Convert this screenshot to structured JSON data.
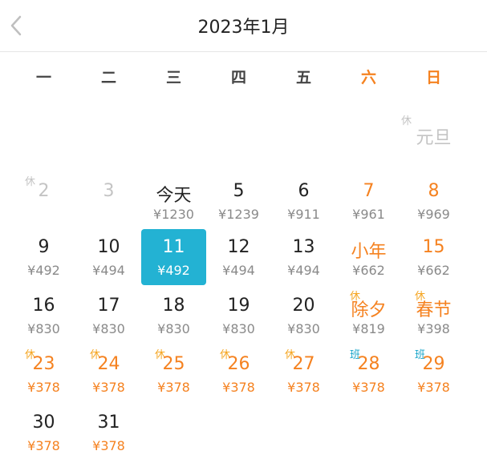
{
  "header": {
    "title": "2023年1月",
    "back_icon": "chevron-left-icon"
  },
  "weekdays": [
    "一",
    "二",
    "三",
    "四",
    "五",
    "六",
    "日"
  ],
  "colors": {
    "accent": "#23b2d3",
    "weekend": "#f58220",
    "rest_tag": "#f5a623",
    "work_tag": "#1aa5c9"
  },
  "days": [
    {
      "label": "元旦",
      "price": "",
      "tag": "休",
      "row": 0,
      "col": 6,
      "disabled": true,
      "weekend": false,
      "orange_price": false
    },
    {
      "label": "2",
      "price": "",
      "tag": "休",
      "row": 1,
      "col": 0,
      "disabled": true,
      "weekend": false,
      "orange_price": false
    },
    {
      "label": "3",
      "price": "",
      "tag": "",
      "row": 1,
      "col": 1,
      "disabled": true,
      "weekend": false,
      "orange_price": false
    },
    {
      "label": "今天",
      "price": "¥1230",
      "tag": "",
      "row": 1,
      "col": 2,
      "weekend": false,
      "orange_price": false
    },
    {
      "label": "5",
      "price": "¥1239",
      "tag": "",
      "row": 1,
      "col": 3,
      "weekend": false,
      "orange_price": false
    },
    {
      "label": "6",
      "price": "¥911",
      "tag": "",
      "row": 1,
      "col": 4,
      "weekend": false,
      "orange_price": false
    },
    {
      "label": "7",
      "price": "¥961",
      "tag": "",
      "row": 1,
      "col": 5,
      "weekend": true,
      "orange_price": false
    },
    {
      "label": "8",
      "price": "¥969",
      "tag": "",
      "row": 1,
      "col": 6,
      "weekend": true,
      "orange_price": false
    },
    {
      "label": "9",
      "price": "¥492",
      "tag": "",
      "row": 2,
      "col": 0,
      "weekend": false,
      "orange_price": false
    },
    {
      "label": "10",
      "price": "¥494",
      "tag": "",
      "row": 2,
      "col": 1,
      "weekend": false,
      "orange_price": false
    },
    {
      "label": "11",
      "price": "¥492",
      "tag": "",
      "row": 2,
      "col": 2,
      "selected": true,
      "weekend": false,
      "orange_price": false
    },
    {
      "label": "12",
      "price": "¥494",
      "tag": "",
      "row": 2,
      "col": 3,
      "weekend": false,
      "orange_price": false
    },
    {
      "label": "13",
      "price": "¥494",
      "tag": "",
      "row": 2,
      "col": 4,
      "weekend": false,
      "orange_price": false
    },
    {
      "label": "小年",
      "price": "¥662",
      "tag": "",
      "row": 2,
      "col": 5,
      "weekend": true,
      "orange_price": false
    },
    {
      "label": "15",
      "price": "¥662",
      "tag": "",
      "row": 2,
      "col": 6,
      "weekend": true,
      "orange_price": false
    },
    {
      "label": "16",
      "price": "¥830",
      "tag": "",
      "row": 3,
      "col": 0,
      "weekend": false,
      "orange_price": false
    },
    {
      "label": "17",
      "price": "¥830",
      "tag": "",
      "row": 3,
      "col": 1,
      "weekend": false,
      "orange_price": false
    },
    {
      "label": "18",
      "price": "¥830",
      "tag": "",
      "row": 3,
      "col": 2,
      "weekend": false,
      "orange_price": false
    },
    {
      "label": "19",
      "price": "¥830",
      "tag": "",
      "row": 3,
      "col": 3,
      "weekend": false,
      "orange_price": false
    },
    {
      "label": "20",
      "price": "¥830",
      "tag": "",
      "row": 3,
      "col": 4,
      "weekend": false,
      "orange_price": false
    },
    {
      "label": "除夕",
      "price": "¥819",
      "tag": "休",
      "row": 3,
      "col": 5,
      "weekend": true,
      "orange_price": false
    },
    {
      "label": "春节",
      "price": "¥398",
      "tag": "休",
      "row": 3,
      "col": 6,
      "weekend": true,
      "orange_price": false
    },
    {
      "label": "23",
      "price": "¥378",
      "tag": "休",
      "row": 4,
      "col": 0,
      "weekend": true,
      "orange_price": true
    },
    {
      "label": "24",
      "price": "¥378",
      "tag": "休",
      "row": 4,
      "col": 1,
      "weekend": true,
      "orange_price": true
    },
    {
      "label": "25",
      "price": "¥378",
      "tag": "休",
      "row": 4,
      "col": 2,
      "weekend": true,
      "orange_price": true
    },
    {
      "label": "26",
      "price": "¥378",
      "tag": "休",
      "row": 4,
      "col": 3,
      "weekend": true,
      "orange_price": true
    },
    {
      "label": "27",
      "price": "¥378",
      "tag": "休",
      "row": 4,
      "col": 4,
      "weekend": true,
      "orange_price": true
    },
    {
      "label": "28",
      "price": "¥378",
      "tag": "班",
      "tag_type": "work",
      "row": 4,
      "col": 5,
      "weekend": true,
      "orange_price": true
    },
    {
      "label": "29",
      "price": "¥378",
      "tag": "班",
      "tag_type": "work",
      "row": 4,
      "col": 6,
      "weekend": true,
      "orange_price": true
    },
    {
      "label": "30",
      "price": "¥378",
      "tag": "",
      "row": 5,
      "col": 0,
      "weekend": false,
      "orange_price": true
    },
    {
      "label": "31",
      "price": "¥378",
      "tag": "",
      "row": 5,
      "col": 1,
      "weekend": false,
      "orange_price": true
    }
  ]
}
